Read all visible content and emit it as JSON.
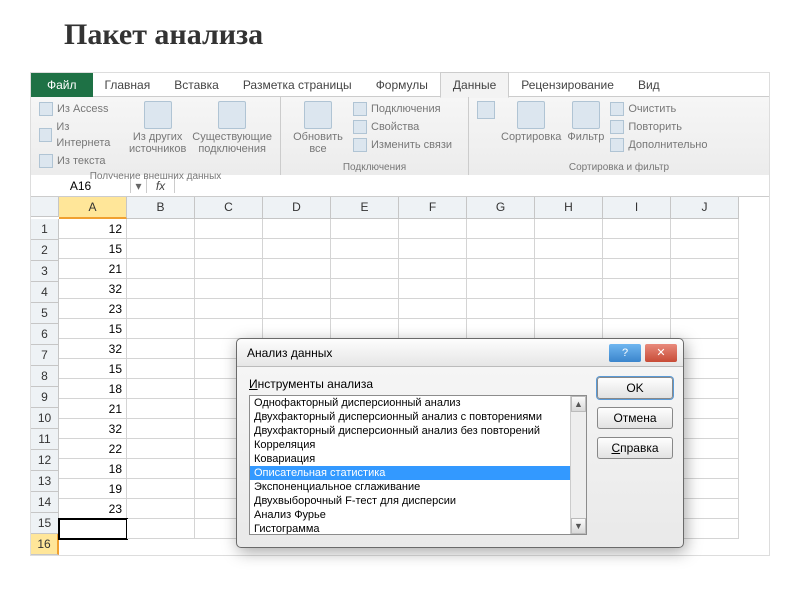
{
  "page": {
    "title": "Пакет анализа"
  },
  "ribbon": {
    "tabs": {
      "file": "Файл",
      "home": "Главная",
      "insert": "Вставка",
      "layout": "Разметка страницы",
      "formulas": "Формулы",
      "data": "Данные",
      "review": "Рецензирование",
      "view": "Вид"
    },
    "groups": {
      "external": {
        "access": "Из Access",
        "web": "Из Интернета",
        "text": "Из текста",
        "other": "Из других источников",
        "existing": "Существующие подключения",
        "title": "Получение внешних данных"
      },
      "connections": {
        "refresh": "Обновить все",
        "conns": "Подключения",
        "props": "Свойства",
        "edit_links": "Изменить связи",
        "title": "Подключения"
      },
      "sortfilter": {
        "sort": "Сортировка",
        "filter": "Фильтр",
        "clear": "Очистить",
        "reapply": "Повторить",
        "advanced": "Дополнительно",
        "title": "Сортировка и фильтр"
      }
    }
  },
  "name_box": "A16",
  "fx_label": "fx",
  "columns": [
    "A",
    "B",
    "C",
    "D",
    "E",
    "F",
    "G",
    "H",
    "I",
    "J"
  ],
  "rows": [
    "1",
    "2",
    "3",
    "4",
    "5",
    "6",
    "7",
    "8",
    "9",
    "10",
    "11",
    "12",
    "13",
    "14",
    "15",
    "16"
  ],
  "col_a": [
    "12",
    "15",
    "21",
    "32",
    "23",
    "15",
    "32",
    "15",
    "18",
    "21",
    "32",
    "22",
    "18",
    "19",
    "23",
    ""
  ],
  "selected_row_index": 15,
  "dialog": {
    "title": "Анализ данных",
    "group_label_prefix": "И",
    "group_label_rest": "нструменты анализа",
    "items": [
      "Однофакторный дисперсионный анализ",
      "Двухфакторный дисперсионный анализ с повторениями",
      "Двухфакторный дисперсионный анализ без повторений",
      "Корреляция",
      "Ковариация",
      "Описательная статистика",
      "Экспоненциальное сглаживание",
      "Двухвыборочный F-тест для дисперсии",
      "Анализ Фурье",
      "Гистограмма"
    ],
    "selected_index": 5,
    "buttons": {
      "ok": "OK",
      "cancel": "Отмена",
      "help_u": "С",
      "help_rest": "правка"
    },
    "win_help": "?",
    "win_close": "✕"
  }
}
